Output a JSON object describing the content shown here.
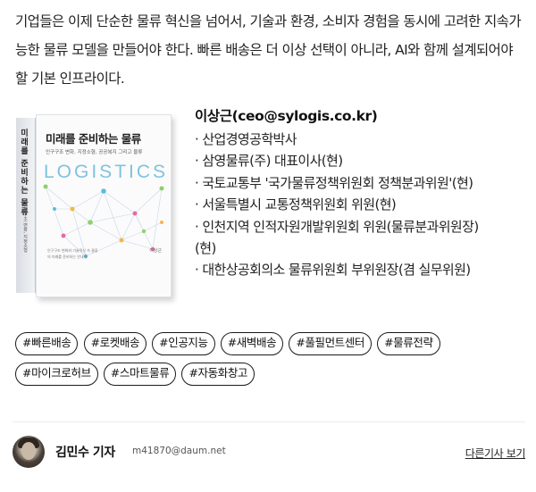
{
  "intro_text": "기업들은 이제 단순한 물류 혁신을 넘어서, 기술과 환경, 소비자 경험을 동시에 고려한 지속가능한 물류 모델을 만들어야 한다. 빠른 배송은 더 이상 선택이 아니라, AI와 함께 설계되어야 할 기본 인프라이다.",
  "book": {
    "title": "미래를 준비하는 물류",
    "subtitle": "인구구조 변화, 지정소형, 공공복지 그리고 물류",
    "logo": "LOGISTICS",
    "spine_title": "미래를 준비하는 물류",
    "spine_sub": "인구구조 변화, 지정소형",
    "author": "이상근",
    "blurb": "인구구조 변화와 기술혁신 속 물류의 미래를 준비하는 안내서"
  },
  "author": {
    "name": "이상근(ceo@sylogis.co.kr)",
    "credentials": [
      "· 산업경영공학박사",
      "· 삼영물류(주) 대표이사(현)",
      "· 국토교통부 '국가물류정책위원회 정책분과위원'(현)",
      "· 서울특별시 교통정책위원회 위원(현)",
      "· 인천지역 인적자원개발위원회 위원(물류분과위원장)",
      "(현)",
      "· 대한상공회의소 물류위원회 부위원장(겸 실무위원)"
    ]
  },
  "tags": [
    "#빠른배송",
    "#로켓배송",
    "#인공지능",
    "#새벽배송",
    "#풀필먼트센터",
    "#물류전략",
    "#마이크로허브",
    "#스마트물류",
    "#자동화창고"
  ],
  "reporter": {
    "name": "김민수 기자",
    "email": "m41870@daum.net",
    "more_label": "다른기사 보기"
  },
  "colors": {
    "tag_border": "#1a1a1a",
    "logo_accent": "#7ec3de",
    "network_dots": [
      "#8fd16a",
      "#f2b84b",
      "#e86aa4",
      "#5bbde0"
    ]
  }
}
